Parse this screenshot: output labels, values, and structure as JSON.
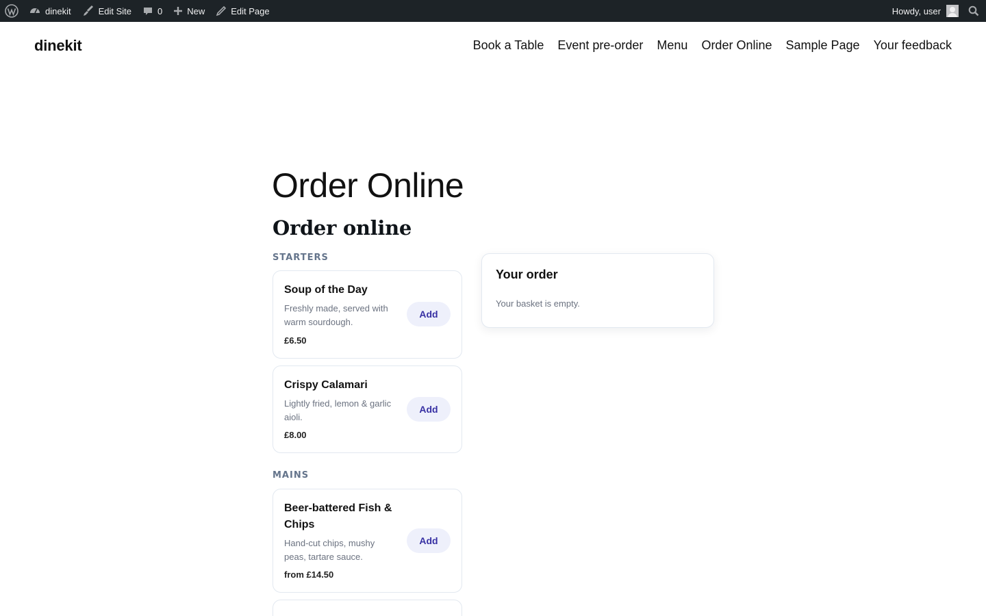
{
  "admin_bar": {
    "site_name": "dinekit",
    "edit_site": "Edit Site",
    "comments_count": "0",
    "new_label": "New",
    "edit_page": "Edit Page",
    "greeting": "Howdy, user"
  },
  "header": {
    "site_title": "dinekit",
    "nav": [
      "Book a Table",
      "Event pre-order",
      "Menu",
      "Order Online",
      "Sample Page",
      "Your feedback"
    ]
  },
  "page": {
    "title": "Order Online",
    "section_title": "Order online"
  },
  "categories": [
    {
      "label": "STARTERS",
      "items": [
        {
          "name": "Soup of the Day",
          "description": "Freshly made, served with warm sourdough.",
          "price": "£6.50",
          "button": "Add"
        },
        {
          "name": "Crispy Calamari",
          "description": "Lightly fried, lemon & garlic aioli.",
          "price": "£8.00",
          "button": "Add"
        }
      ]
    },
    {
      "label": "MAINS",
      "items": [
        {
          "name": "Beer-battered Fish & Chips",
          "description": "Hand-cut chips, mushy peas, tartare sauce.",
          "price": "from £14.50",
          "button": "Add"
        }
      ]
    }
  ],
  "order": {
    "title": "Your order",
    "empty_text": "Your basket is empty."
  },
  "colors": {
    "admin_bar_bg": "#1d2327",
    "accent": "#3730a3",
    "button_bg": "#eef0fb"
  }
}
